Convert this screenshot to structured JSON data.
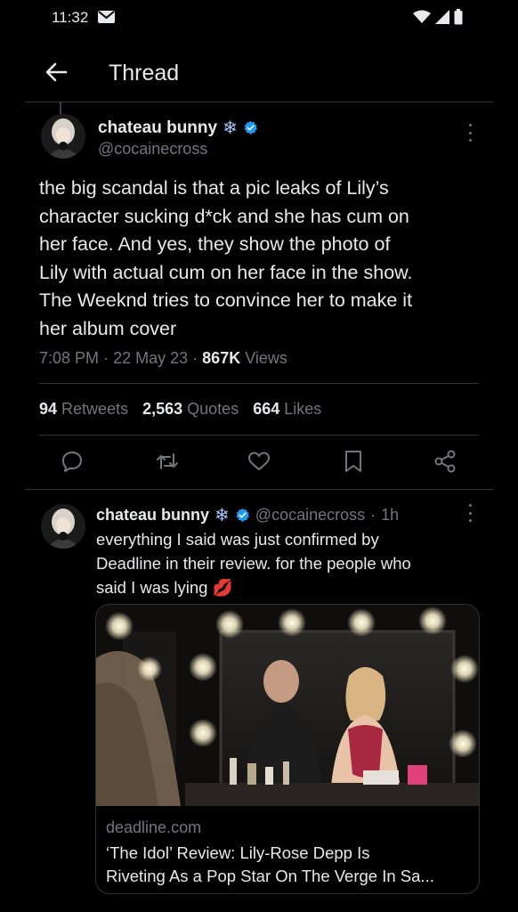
{
  "status_bar": {
    "time": "11:32"
  },
  "header": {
    "title": "Thread"
  },
  "main_tweet": {
    "display_name": "chateau bunny",
    "handle": "@cocainecross",
    "text_lines": [
      "the big scandal is that a pic leaks of Lily’s",
      "character sucking d*ck and she has cum on",
      "her face. And yes, they show the photo of",
      "Lily with actual cum on her face in the show.",
      "The Weeknd tries to convince her to make it",
      "her album cover"
    ],
    "time": "7:08 PM",
    "date": "22 May 23",
    "views_count": "867K",
    "views_label": "Views",
    "retweets_count": "94",
    "retweets_label": "Retweets",
    "quotes_count": "2,563",
    "quotes_label": "Quotes",
    "likes_count": "664",
    "likes_label": "Likes"
  },
  "reply_tweet": {
    "display_name": "chateau bunny",
    "handle": "@cocainecross",
    "age": "1h",
    "text_lines": [
      "everything I said was just confirmed by",
      "Deadline in their review. for the people who",
      "said I was lying"
    ],
    "emoji": "💋",
    "card": {
      "domain": "deadline.com",
      "title_lines": [
        "‘The Idol’ Review: Lily-Rose Depp Is",
        "Riveting As a Pop Star On The Verge In Sa..."
      ]
    }
  },
  "colors": {
    "background": "#000000",
    "text_primary": "#e7e9ea",
    "text_secondary": "#71767b",
    "verified_blue": "#1d9bf0",
    "divider": "#2f3336",
    "emoji_red": "#e0245e"
  },
  "icons": {
    "back": "arrow-left-icon",
    "verified": "verified-badge-icon",
    "snowflake": "snowflake-icon",
    "more": "more-vertical-icon",
    "reply": "reply-icon",
    "retweet": "retweet-icon",
    "like": "heart-icon",
    "bookmark": "bookmark-icon",
    "share": "share-icon"
  }
}
